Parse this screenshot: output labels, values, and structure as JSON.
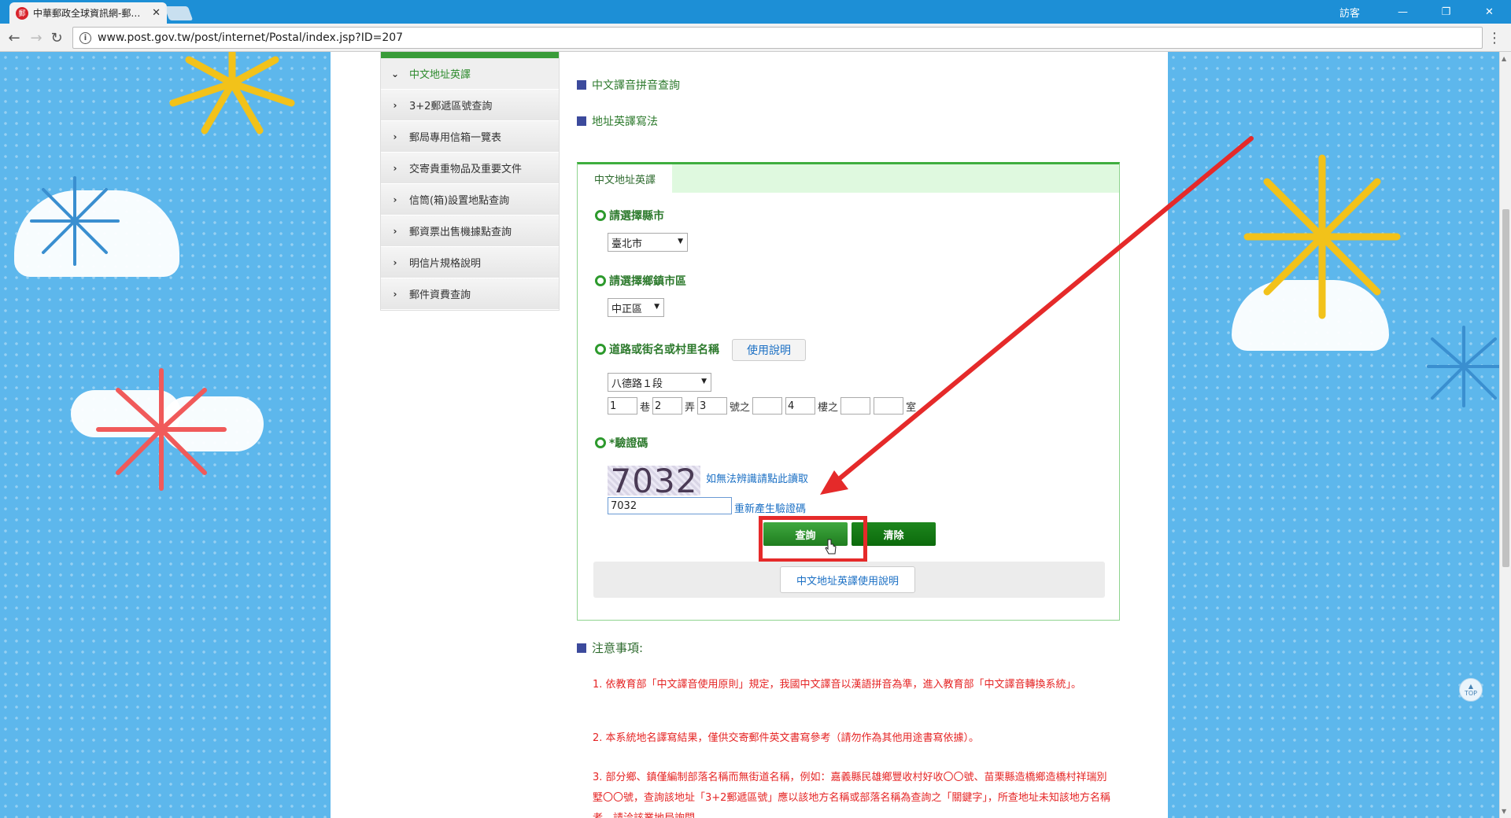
{
  "browser": {
    "tab_title": "中華郵政全球資訊網-郵…",
    "tab_close": "✕",
    "user_label": "訪客",
    "minimize": "—",
    "restore": "❐",
    "close": "✕",
    "url": "www.post.gov.tw/post/internet/Postal/index.jsp?ID=207"
  },
  "sidebar": {
    "items": [
      {
        "label": "中文地址英譯",
        "active": true
      },
      {
        "label": "3+2郵遞區號查詢"
      },
      {
        "label": "郵局專用信箱一覽表"
      },
      {
        "label": "交寄貴重物品及重要文件"
      },
      {
        "label": "信筒(箱)設置地點查詢"
      },
      {
        "label": "郵資票出售機據點查詢"
      },
      {
        "label": "明信片規格說明"
      },
      {
        "label": "郵件資費查詢"
      }
    ]
  },
  "links": {
    "pinyin": "中文譯音拼音查詢",
    "writing": "地址英譯寫法"
  },
  "form": {
    "tab": "中文地址英譯",
    "county_label": "請選擇縣市",
    "county_value": "臺北市",
    "district_label": "請選擇鄉鎮市區",
    "district_value": "中正區",
    "road_label": "道路或街名或村里名稱",
    "help_button": "使用說明",
    "road_value": "八德路１段",
    "lane": "1",
    "lane_unit": "巷",
    "alley": "2",
    "alley_unit": "弄",
    "number": "3",
    "number_unit": "號之",
    "number_sub": "",
    "floor": "4",
    "floor_unit": "樓之",
    "floor_sub": "",
    "room": "",
    "room_unit": "室",
    "captcha_label": "*驗證碼",
    "captcha_image_text": "7032",
    "captcha_cant_read": "如無法辨識請點此讀取",
    "captcha_value": "7032",
    "captcha_regen": "重新產生驗證碼",
    "search_button": "查詢",
    "clear_button": "清除",
    "manual_button": "中文地址英譯使用說明"
  },
  "notes": {
    "title": "注意事項:",
    "items": [
      "1. 依教育部「中文譯音使用原則」規定，我國中文譯音以漢語拼音為準，進入教育部「中文譯音轉換系統」。",
      "2. 本系統地名譯寫結果，僅供交寄郵件英文書寫參考（請勿作為其他用途書寫依據）。",
      "3. 部分鄉、鎮僅編制部落名稱而無街道名稱，例如：嘉義縣民雄鄉豐收村好收〇〇號、苗栗縣造橋鄉造橋村祥瑞別墅〇〇號，查詢該地址「3+2郵遞區號」應以該地方名稱或部落名稱為查詢之「關鍵字」，所查地址未知該地方名稱者，請洽該業地局詢問。"
    ]
  },
  "top_button": "TOP",
  "colors": {
    "sky": "#5db7ec",
    "green": "#2d9a2d",
    "annotation_red": "#e52a2a"
  }
}
